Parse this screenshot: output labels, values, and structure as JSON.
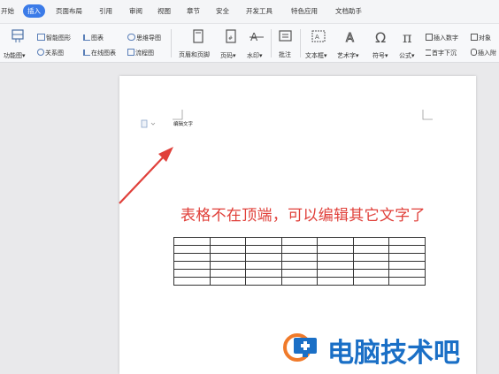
{
  "menu": {
    "tabs": [
      "开始",
      "插入",
      "页面布局",
      "引用",
      "审阅",
      "视图",
      "章节",
      "安全",
      "开发工具",
      "特色应用",
      "文档助手"
    ],
    "active_tab": "插入"
  },
  "ribbon": {
    "function_chart": "功能图",
    "smart_shape": "智能图形",
    "chart": "图表",
    "mind_map": "思维导图",
    "relation_chart": "关系图",
    "online_chart": "在线图表",
    "flow_chart": "流程图",
    "header_footer": "页眉和页脚",
    "page_number": "页码",
    "watermark": "水印",
    "comment": "批注",
    "textbox": "文本框",
    "wordart": "艺术字",
    "symbol": "符号",
    "formula": "公式",
    "insert_number": "插入数字",
    "object": "对象",
    "drop_cap": "首字下沉",
    "insert_more": "插入附"
  },
  "document": {
    "edit_text": "编辑文字",
    "annotation": "表格不在顶端，可以编辑其它文字了",
    "table": {
      "rows": 6,
      "cols": 7
    }
  },
  "watermark_brand": "电脑技术吧",
  "colors": {
    "accent": "#3b7be8",
    "annotation": "#e0403a",
    "brand": "#1a6fc6"
  }
}
